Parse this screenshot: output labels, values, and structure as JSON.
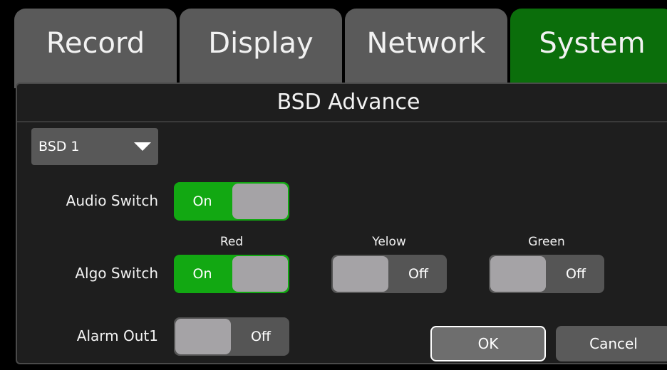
{
  "tabs": [
    {
      "label": "Record",
      "active": false
    },
    {
      "label": "Display",
      "active": false
    },
    {
      "label": "Network",
      "active": false
    },
    {
      "label": "System",
      "active": true
    }
  ],
  "colors": {
    "active_tab": "#0b6e0b",
    "toggle_on": "#12a812",
    "toggle_off": "#555555"
  },
  "panel": {
    "title": "BSD Advance",
    "dropdown": {
      "selected": "BSD 1",
      "icon": "chevron-down-icon"
    },
    "rows": {
      "audio_switch": {
        "label": "Audio Switch",
        "state": "On"
      },
      "algo_switch": {
        "label": "Algo Switch",
        "columns": [
          {
            "label": "Red",
            "state": "On"
          },
          {
            "label": "Yelow",
            "state": "Off"
          },
          {
            "label": "Green",
            "state": "Off"
          }
        ]
      },
      "alarm_out1": {
        "label": "Alarm Out1",
        "state": "Off"
      }
    },
    "buttons": {
      "ok": "OK",
      "cancel": "Cancel"
    }
  }
}
